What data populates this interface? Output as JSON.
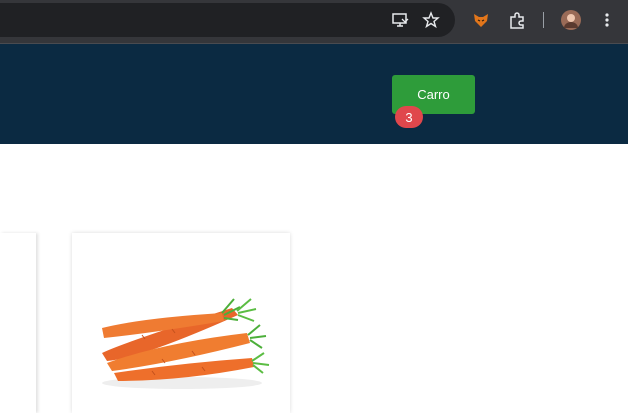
{
  "browser": {
    "icons": [
      "screen-cast-icon",
      "star-icon",
      "fox-extension-icon",
      "puzzle-icon",
      "profile-avatar",
      "more-vert-icon"
    ]
  },
  "header": {
    "cart_label": "Carro",
    "cart_count": "3"
  },
  "product": {
    "image": "carrot-image"
  },
  "colors": {
    "header_bg": "#0b2a42",
    "cart_button": "#2e9c3a",
    "badge": "#e0474c"
  }
}
